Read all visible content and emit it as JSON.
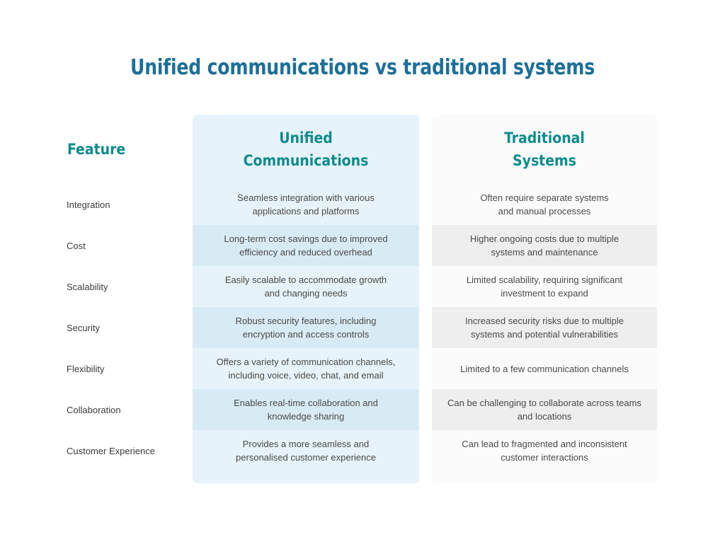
{
  "title": "Unified communications vs traditional systems",
  "colors": {
    "title": "#1d6f99",
    "header_text": "#0f8b8d",
    "body_text": "#4a4a4a",
    "feature_text": "#3d3d3d",
    "uc_column_bg": "#e6f3fa",
    "uc_column_alt_bg": "#d8ebf4",
    "traditional_column_bg": "#fbfbfb",
    "traditional_column_alt_bg": "#eeeeee",
    "page_bg": "#ffffff"
  },
  "headers": {
    "feature": "Feature",
    "unified_line1": "Unified",
    "unified_line2": "Communications",
    "traditional_line1": "Traditional",
    "traditional_line2": "Systems"
  },
  "chart_data": {
    "type": "table",
    "title": "Unified communications vs traditional systems",
    "columns": [
      "Feature",
      "Unified Communications",
      "Traditional Systems"
    ],
    "rows": [
      {
        "feature": "Integration",
        "unified": "Seamless integration with various applications and platforms",
        "traditional": "Often require separate systems and manual processes"
      },
      {
        "feature": "Cost",
        "unified": "Long-term cost savings due to improved efficiency and reduced overhead",
        "traditional": "Higher ongoing costs due to multiple systems and maintenance"
      },
      {
        "feature": "Scalability",
        "unified": "Easily scalable to accommodate growth and changing needs",
        "traditional": "Limited scalability, requiring significant investment to expand"
      },
      {
        "feature": "Security",
        "unified": "Robust security features, including encryption and access controls",
        "traditional": "Increased security risks due to multiple systems and potential vulnerabilities"
      },
      {
        "feature": "Flexibility",
        "unified": "Offers a variety of communication channels, including voice, video, chat, and email",
        "traditional": "Limited to a few communication channels"
      },
      {
        "feature": "Collaboration",
        "unified": "Enables real-time collaboration and knowledge sharing",
        "traditional": "Can be challenging to collaborate across teams and locations"
      },
      {
        "feature": "Customer Experience",
        "unified": "Provides a more seamless and personalised customer experience",
        "traditional": "Can lead to fragmented and inconsistent customer interactions"
      }
    ]
  },
  "rows_display": [
    {
      "feature": "Integration",
      "unified": [
        "Seamless integration with various",
        "applications and platforms"
      ],
      "traditional": [
        "Often require separate systems",
        "and manual processes"
      ]
    },
    {
      "feature": "Cost",
      "unified": [
        "Long-term cost savings due to improved",
        "efficiency and reduced overhead"
      ],
      "traditional": [
        "Higher ongoing costs due to multiple",
        "systems and maintenance"
      ]
    },
    {
      "feature": "Scalability",
      "unified": [
        "Easily scalable to accommodate growth",
        "and changing needs"
      ],
      "traditional": [
        "Limited scalability, requiring significant",
        "investment to expand"
      ]
    },
    {
      "feature": "Security",
      "unified": [
        "Robust security features, including",
        "encryption and access controls"
      ],
      "traditional": [
        "Increased security risks due to multiple",
        "systems and potential vulnerabilities"
      ]
    },
    {
      "feature": "Flexibility",
      "unified": [
        "Offers a variety of communication channels,",
        "including voice, video, chat, and email"
      ],
      "traditional": [
        "Limited to a few communication channels"
      ]
    },
    {
      "feature": "Collaboration",
      "unified": [
        "Enables real-time collaboration and",
        "knowledge sharing"
      ],
      "traditional": [
        "Can be challenging to collaborate across teams",
        "and locations"
      ]
    },
    {
      "feature": "Customer Experience",
      "unified": [
        "Provides a more seamless and",
        "personalised customer experience"
      ],
      "traditional": [
        "Can lead to fragmented and inconsistent",
        "customer interactions"
      ]
    }
  ]
}
